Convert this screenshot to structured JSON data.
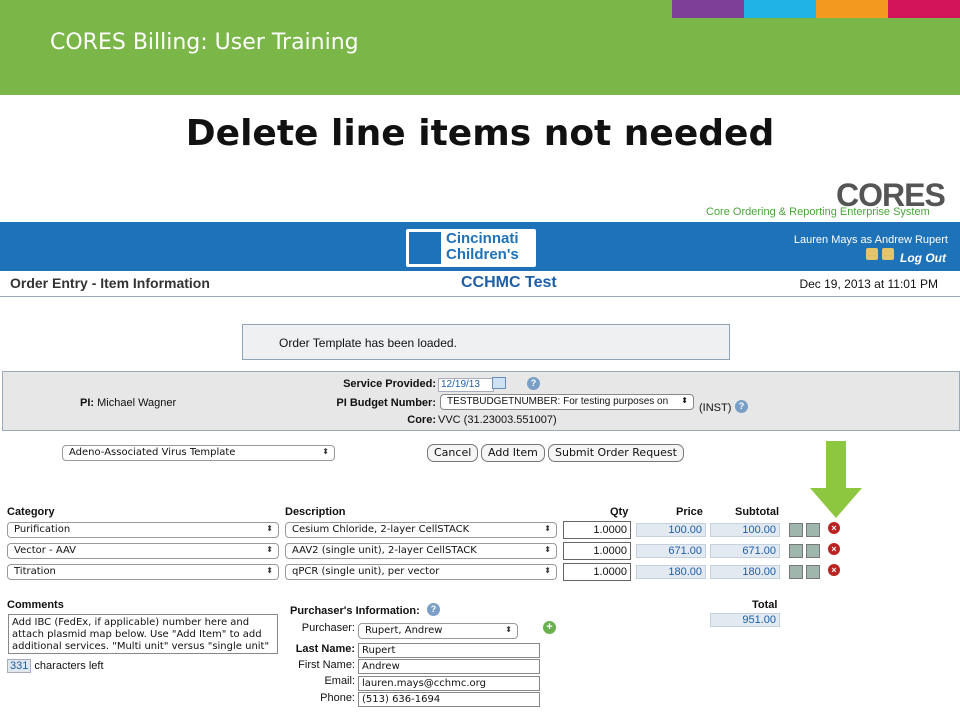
{
  "slide": {
    "title": "CORES Billing: User Training",
    "heading": "Delete line items not needed",
    "tab_colors": [
      "#7e3f98",
      "#1fb3e6",
      "#f39a1e",
      "#d4145a"
    ]
  },
  "logo": {
    "name": "CORES",
    "tagline": "Core Ordering & Reporting Enterprise System"
  },
  "app": {
    "brand_line1": "Cincinnati",
    "brand_line2": "Children's",
    "user": "Lauren Mays as Andrew Rupert",
    "logout": "Log Out",
    "page_title": "Order Entry - Item Information",
    "test_title": "CCHMC Test",
    "date": "Dec 19, 2013 at 11:01 PM",
    "message": "Order Template has been loaded."
  },
  "info": {
    "pi_label": "PI:",
    "pi_value": "Michael Wagner",
    "service_label": "Service Provided:",
    "service_date": "12/19/13",
    "budget_label": "PI Budget Number:",
    "budget_value": "TESTBUDGETNUMBER: For testing purposes on",
    "inst": "(INST)",
    "core_label": "Core:",
    "core_value": "VVC (31.23003.551007)"
  },
  "toolbar": {
    "template": "Adeno-Associated Virus Template",
    "cancel": "Cancel",
    "add_item": "Add Item",
    "submit": "Submit Order Request"
  },
  "table": {
    "headers": {
      "category": "Category",
      "description": "Description",
      "qty": "Qty",
      "price": "Price",
      "subtotal": "Subtotal"
    },
    "rows": [
      {
        "category": "Purification",
        "description": "Cesium Chloride, 2-layer CellSTACK",
        "qty": "1.0000",
        "price": "100.00",
        "subtotal": "100.00"
      },
      {
        "category": "Vector - AAV",
        "description": "AAV2 (single unit), 2-layer CellSTACK",
        "qty": "1.0000",
        "price": "671.00",
        "subtotal": "671.00"
      },
      {
        "category": "Titration",
        "description": "qPCR (single unit), per vector",
        "qty": "1.0000",
        "price": "180.00",
        "subtotal": "180.00"
      }
    ],
    "total_label": "Total",
    "total": "951.00"
  },
  "comments": {
    "label": "Comments",
    "text": "Add IBC (FedEx, if applicable) number here and attach plasmid map below. Use \"Add Item\" to add additional services. \"Multi unit\" versus \"single unit\" allows for",
    "chars_count": "331",
    "chars_label": "characters left"
  },
  "purchaser": {
    "heading": "Purchaser's Information:",
    "purchaser_label": "Purchaser:",
    "purchaser_value": "Rupert, Andrew",
    "last_label": "Last Name:",
    "last_value": "Rupert",
    "first_label": "First Name:",
    "first_value": "Andrew",
    "email_label": "Email:",
    "email_value": "lauren.mays@cchmc.org",
    "phone_label": "Phone:",
    "phone_value": "(513) 636-1694"
  }
}
